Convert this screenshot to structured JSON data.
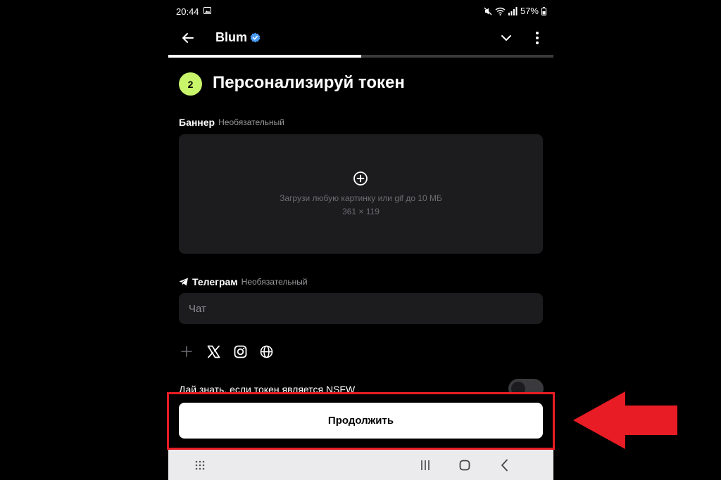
{
  "status_bar": {
    "time": "20:44",
    "battery": "57%"
  },
  "app_bar": {
    "title": "Blum"
  },
  "progress": {
    "value": 0.5
  },
  "step": {
    "number": "2",
    "title": "Персонализируй токен"
  },
  "banner": {
    "label": "Баннер",
    "optional": "Необязательный",
    "hint": "Загрузи любую картинку или gif до 10 МБ",
    "size": "361 × 119"
  },
  "telegram": {
    "label": "Телеграм",
    "optional": "Необязательный",
    "placeholder": "Чат",
    "value": ""
  },
  "socials": [
    "plus-icon",
    "x-icon",
    "instagram-icon",
    "globe-icon"
  ],
  "nsfw": {
    "label": "Дай знать, если токен является NSFW",
    "enabled": false
  },
  "continue_button": {
    "label": "Продолжить"
  },
  "colors": {
    "accent": "#c9f56b",
    "background": "#000000",
    "surface": "#1c1c1e",
    "highlight": "#e81c24"
  }
}
